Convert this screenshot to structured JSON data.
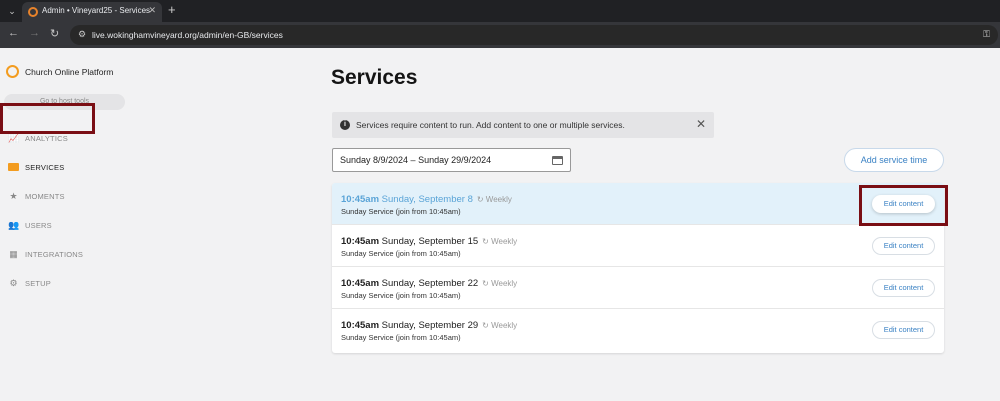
{
  "browser": {
    "tab_title": "Admin • Vineyard25 - Services",
    "tab_close": "✕",
    "new_tab": "+",
    "url": "live.wokinghamvineyard.org/admin/en-GB/services"
  },
  "sidebar": {
    "brand": "Church Online Platform",
    "host_tools": "Go to host tools",
    "items": [
      {
        "label": "ANALYTICS",
        "icon": "chart-icon"
      },
      {
        "label": "SERVICES",
        "icon": "services-icon"
      },
      {
        "label": "MOMENTS",
        "icon": "star-icon"
      },
      {
        "label": "USERS",
        "icon": "users-icon"
      },
      {
        "label": "INTEGRATIONS",
        "icon": "integrations-icon"
      },
      {
        "label": "SETUP",
        "icon": "gear-icon"
      }
    ]
  },
  "main": {
    "title": "Services",
    "notice": "Services require content to run. Add content to one or multiple services.",
    "date_range": "Sunday 8/9/2024 – Sunday 29/9/2024",
    "add_button": "Add service time",
    "services": [
      {
        "time": "10:45am",
        "date": "Sunday, September 8",
        "recurrence": "Weekly",
        "subtitle": "Sunday Service (join from 10:45am)",
        "button": "Edit content"
      },
      {
        "time": "10:45am",
        "date": "Sunday, September 15",
        "recurrence": "Weekly",
        "subtitle": "Sunday Service (join from 10:45am)",
        "button": "Edit content"
      },
      {
        "time": "10:45am",
        "date": "Sunday, September 22",
        "recurrence": "Weekly",
        "subtitle": "Sunday Service (join from 10:45am)",
        "button": "Edit content"
      },
      {
        "time": "10:45am",
        "date": "Sunday, September 29",
        "recurrence": "Weekly",
        "subtitle": "Sunday Service (join from 10:45am)",
        "button": "Edit content"
      }
    ]
  },
  "colors": {
    "accent": "#f39c1f",
    "link": "#3b82c4",
    "highlight_row": "#e2f1fa",
    "annotation_box": "#7a0e14"
  }
}
